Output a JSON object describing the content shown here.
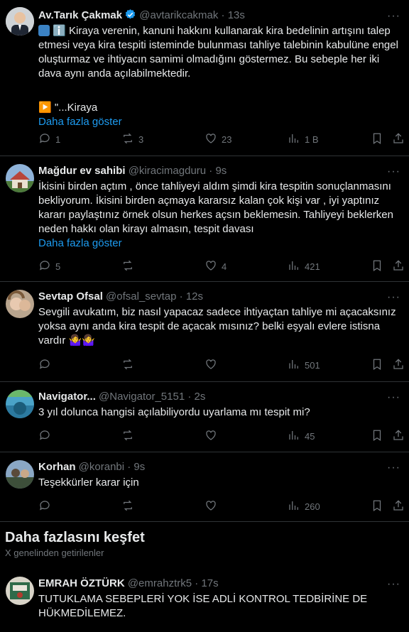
{
  "tweets": [
    {
      "name": "Av.Tarık Çakmak",
      "handle": "@avtarikcakmak · 13s",
      "lines": [
        "ℹ️ Kiraya verenin, kanuni hakkını kullanarak kira bedelinin artışını talep etmesi veya kira tespiti isteminde bulunması tahliye talebinin kabulüne engel oluşturmaz ve ihtiyacın samimi olmadığını göstermez. Bu sebeple her iki dava aynı anda açılabilmektedir.",
        "",
        "▶️ \"...Kiraya"
      ],
      "show_more": "Daha fazla göster",
      "reply": "1",
      "retweet": "3",
      "like": "23",
      "views": "1 B"
    },
    {
      "name": "Mağdur ev sahibi",
      "handle": "@kiracimagduru · 9s",
      "lines": [
        "İkisini birden açtım , önce tahliyeyi aldım şimdi kira tespitin sonuçlanmasını bekliyorum. İkisini birden açmaya kararsız kalan çok kişi var , iyi yaptınız kararı paylaştınız örnek olsun herkes açsın beklemesin. Tahliyeyi beklerken neden hakkı olan kirayı almasın, tespit davası"
      ],
      "show_more": "Daha fazla göster",
      "reply": "5",
      "retweet": "",
      "like": "4",
      "views": "421"
    },
    {
      "name": "Sevtap Ofsal",
      "handle": "@ofsal_sevtap · 12s",
      "lines": [
        "Sevgili avukatım, biz nasıl yapacaz sadece ihtiyaçtan tahliye mi açacaksınız yoksa aynı anda kira tespit de açacak mısınız? belki eşyalı evlere istisna vardır"
      ],
      "emoji": "🤷‍♀️🤷‍♀️",
      "reply": "",
      "retweet": "",
      "like": "",
      "views": "501"
    },
    {
      "name": "Navigator...",
      "handle": "@Navigator_5151 · 2s",
      "lines": [
        "3 yıl dolunca hangisi açılabiliyordu uyarlama mı tespit mi?"
      ],
      "reply": "",
      "retweet": "",
      "like": "",
      "views": "45"
    },
    {
      "name": "Korhan",
      "handle": "@koranbi · 9s",
      "lines": [
        "Teşekkürler karar için"
      ],
      "reply": "",
      "retweet": "",
      "like": "",
      "views": "260"
    },
    {
      "name": "EMRAH ÖZTÜRK",
      "handle": "@emrahztrk5 · 17s",
      "lines": [
        "TUTUKLAMA SEBEPLERİ YOK İSE ADLİ KONTROL TEDBİRİNE DE HÜKMEDİLEMEZ."
      ]
    }
  ],
  "discover": {
    "title": "Daha fazlasını keşfet",
    "subtitle": "X genelinden getirilenler"
  },
  "colors": {
    "background": "#000000",
    "text": "#e7e9ea",
    "muted": "#71767b",
    "link": "#1d9bf0",
    "verified": "#1d9bf0",
    "divider": "#2f3336"
  }
}
